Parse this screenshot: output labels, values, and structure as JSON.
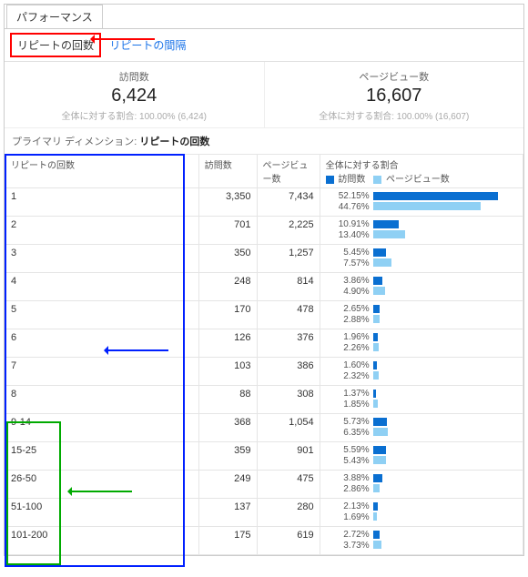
{
  "tabs": {
    "performance": "パフォーマンス",
    "repeat_count": "リピートの回数",
    "repeat_interval": "リピートの間隔"
  },
  "summary": {
    "visits_label": "訪問数",
    "visits_value": "6,424",
    "visits_sub_prefix": "全体に対する割合:",
    "visits_sub_pct": "100.00%",
    "visits_sub_paren": "(6,424)",
    "pv_label": "ページビュー数",
    "pv_value": "16,607",
    "pv_sub_prefix": "全体に対する割合:",
    "pv_sub_pct": "100.00%",
    "pv_sub_paren": "(16,607)"
  },
  "dimension": {
    "prefix": "プライマリ ディメンション:",
    "value": "リピートの回数"
  },
  "headers": {
    "col0": "リピートの回数",
    "col1": "訪問数",
    "col2": "ページビュー数",
    "col3": "全体に対する割合",
    "legend_visits": "訪問数",
    "legend_pv": "ページビュー数"
  },
  "rows": [
    {
      "label": "1",
      "visits": "3,350",
      "pv": "7,434",
      "visits_pct": "52.15%",
      "pv_pct": "44.76%",
      "vb": 52.15,
      "pb": 44.76
    },
    {
      "label": "2",
      "visits": "701",
      "pv": "2,225",
      "visits_pct": "10.91%",
      "pv_pct": "13.40%",
      "vb": 10.91,
      "pb": 13.4
    },
    {
      "label": "3",
      "visits": "350",
      "pv": "1,257",
      "visits_pct": "5.45%",
      "pv_pct": "7.57%",
      "vb": 5.45,
      "pb": 7.57
    },
    {
      "label": "4",
      "visits": "248",
      "pv": "814",
      "visits_pct": "3.86%",
      "pv_pct": "4.90%",
      "vb": 3.86,
      "pb": 4.9
    },
    {
      "label": "5",
      "visits": "170",
      "pv": "478",
      "visits_pct": "2.65%",
      "pv_pct": "2.88%",
      "vb": 2.65,
      "pb": 2.88
    },
    {
      "label": "6",
      "visits": "126",
      "pv": "376",
      "visits_pct": "1.96%",
      "pv_pct": "2.26%",
      "vb": 1.96,
      "pb": 2.26
    },
    {
      "label": "7",
      "visits": "103",
      "pv": "386",
      "visits_pct": "1.60%",
      "pv_pct": "2.32%",
      "vb": 1.6,
      "pb": 2.32
    },
    {
      "label": "8",
      "visits": "88",
      "pv": "308",
      "visits_pct": "1.37%",
      "pv_pct": "1.85%",
      "vb": 1.37,
      "pb": 1.85
    },
    {
      "label": "9-14",
      "visits": "368",
      "pv": "1,054",
      "visits_pct": "5.73%",
      "pv_pct": "6.35%",
      "vb": 5.73,
      "pb": 6.35
    },
    {
      "label": "15-25",
      "visits": "359",
      "pv": "901",
      "visits_pct": "5.59%",
      "pv_pct": "5.43%",
      "vb": 5.59,
      "pb": 5.43
    },
    {
      "label": "26-50",
      "visits": "249",
      "pv": "475",
      "visits_pct": "3.88%",
      "pv_pct": "2.86%",
      "vb": 3.88,
      "pb": 2.86
    },
    {
      "label": "51-100",
      "visits": "137",
      "pv": "280",
      "visits_pct": "2.13%",
      "pv_pct": "1.69%",
      "vb": 2.13,
      "pb": 1.69
    },
    {
      "label": "101-200",
      "visits": "175",
      "pv": "619",
      "visits_pct": "2.72%",
      "pv_pct": "3.73%",
      "vb": 2.72,
      "pb": 3.73
    }
  ],
  "chart_data": {
    "type": "bar",
    "title": "全体に対する割合",
    "categories": [
      "1",
      "2",
      "3",
      "4",
      "5",
      "6",
      "7",
      "8",
      "9-14",
      "15-25",
      "26-50",
      "51-100",
      "101-200"
    ],
    "series": [
      {
        "name": "訪問数",
        "values": [
          52.15,
          10.91,
          5.45,
          3.86,
          2.65,
          1.96,
          1.6,
          1.37,
          5.73,
          5.59,
          3.88,
          2.13,
          2.72
        ]
      },
      {
        "name": "ページビュー数",
        "values": [
          44.76,
          13.4,
          7.57,
          4.9,
          2.88,
          2.26,
          2.32,
          1.85,
          6.35,
          5.43,
          2.86,
          1.69,
          3.73
        ]
      }
    ],
    "xlabel": "",
    "ylabel": "%",
    "ylim": [
      0,
      60
    ]
  }
}
